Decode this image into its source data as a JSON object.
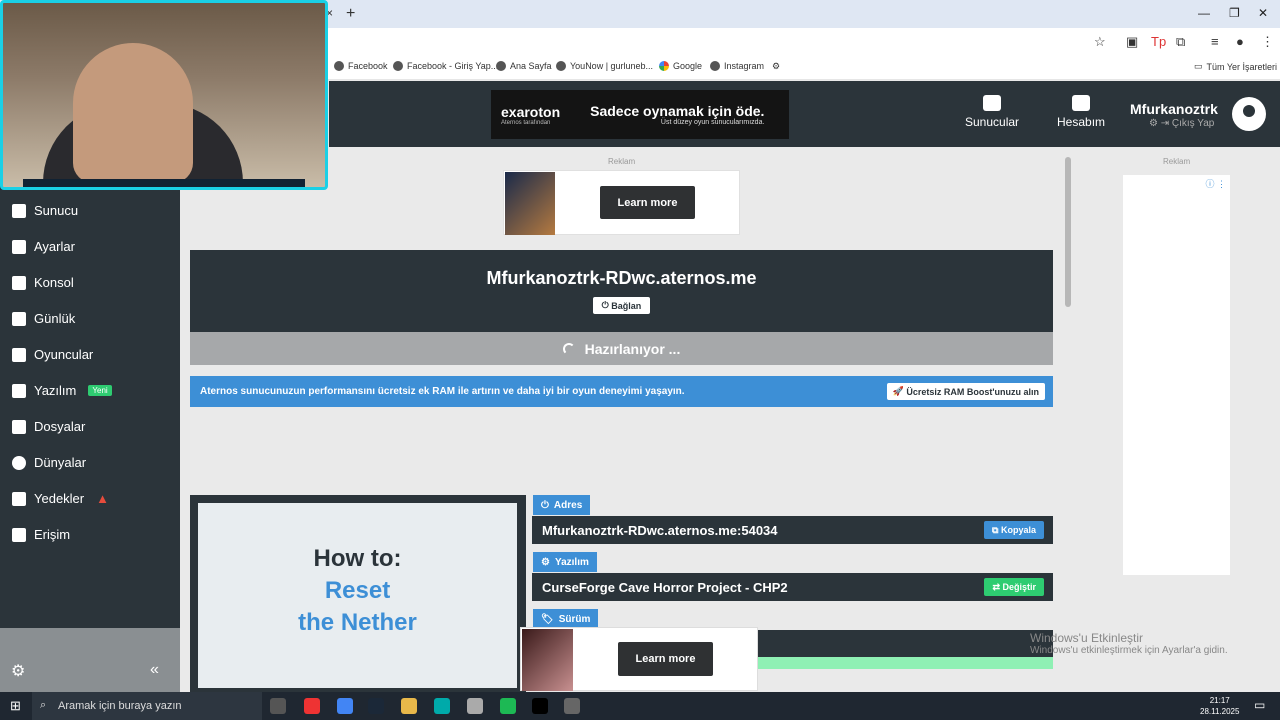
{
  "browser": {
    "new_tab": "+",
    "close_tab": "×",
    "window_min": "—",
    "window_restore": "❐",
    "window_close": "✕",
    "bookmarks": [
      "Facebook",
      "Facebook - Giriş Yap...",
      "Ana Sayfa",
      "YouNow | gurluneb...",
      "Google",
      "Instagram"
    ],
    "all_bookmarks": "Tüm Yer İşaretleri"
  },
  "header": {
    "ad_brand": "exaroton",
    "ad_brand_sub": "Aternos tarafından",
    "ad_tagline": "Sadece oynamak için öde.",
    "ad_tagline_sub": "Üst düzey oyun sunucularımızda.",
    "nav_servers": "Sunucular",
    "nav_account": "Hesabım",
    "username": "Mfurkanoztrk",
    "logout": "Çıkış Yap"
  },
  "sidebar": {
    "items": [
      {
        "label": "Sunucu"
      },
      {
        "label": "Ayarlar"
      },
      {
        "label": "Konsol"
      },
      {
        "label": "Günlük"
      },
      {
        "label": "Oyuncular"
      },
      {
        "label": "Yazılım",
        "badge": "Yeni"
      },
      {
        "label": "Dosyalar"
      },
      {
        "label": "Dünyalar"
      },
      {
        "label": "Yedekler"
      },
      {
        "label": "Erişim"
      }
    ],
    "collapse": "«"
  },
  "main": {
    "ad_label": "Reklam",
    "learn_more": "Learn more",
    "server_address": "Mfurkanoztrk-RDwc.aternos.me",
    "connect": "Bağlan",
    "status": "Hazırlanıyor ...",
    "promo_text": "Aternos sunucunuzun performansını ücretsiz ek RAM ile artırın ve daha iyi bir oyun deneyimi yaşayın.",
    "promo_button": "Ücretsiz RAM Boost'unuzu alın",
    "video_line1": "How to:",
    "video_line2": "Reset",
    "video_line3": "the Nether",
    "address_label": "Adres",
    "address_value": "Mfurkanoztrk-RDwc.aternos.me:54034",
    "copy": "Kopyala",
    "software_label": "Yazılım",
    "software_value": "CurseForge Cave Horror Project - CHP2",
    "change": "Değiştir",
    "version_label": "Sürüm"
  },
  "right": {
    "ad_label": "Reklam"
  },
  "windows": {
    "activate_title": "Windows'u Etkinleştir",
    "activate_sub": "Windows'u etkinleştirmek için Ayarlar'a gidin."
  },
  "taskbar": {
    "search_placeholder": "Aramak için buraya yazın",
    "time": "21:17",
    "date": "28.11.2025"
  }
}
